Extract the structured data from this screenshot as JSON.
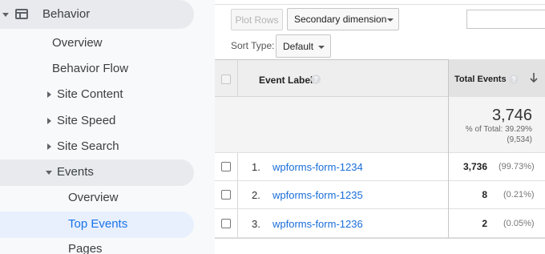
{
  "sidebar": {
    "behavior": "Behavior",
    "overview": "Overview",
    "behavior_flow": "Behavior Flow",
    "site_content": "Site Content",
    "site_speed": "Site Speed",
    "site_search": "Site Search",
    "events": "Events",
    "events_overview": "Overview",
    "top_events": "Top Events",
    "pages": "Pages"
  },
  "toolbar": {
    "plot_rows": "Plot Rows",
    "secondary_dimension": "Secondary dimension",
    "sort_type_label": "Sort Type:",
    "sort_type_value": "Default"
  },
  "table": {
    "header_event_label": "Event Label",
    "header_total_events": "Total Events",
    "summary": {
      "total": "3,746",
      "pct_of_total": "% of Total: 39.29%",
      "site_total": "(9,534)"
    },
    "rows": [
      {
        "num": "1.",
        "label": "wpforms-form-1234",
        "value": "3,736",
        "pct": "(99.73%)"
      },
      {
        "num": "2.",
        "label": "wpforms-form-1235",
        "value": "8",
        "pct": "(0.21%)"
      },
      {
        "num": "3.",
        "label": "wpforms-form-1236",
        "value": "2",
        "pct": "(0.05%)"
      }
    ]
  },
  "colors": {
    "link": "#1a6ed8",
    "active_nav": "#1a73e8",
    "active_nav_bg": "#e8f0fe"
  },
  "icons": [
    "behavior-icon",
    "caret-down-icon",
    "caret-right-icon",
    "help-icon",
    "sort-arrow-down-icon",
    "dropdown-arrow-icon"
  ]
}
